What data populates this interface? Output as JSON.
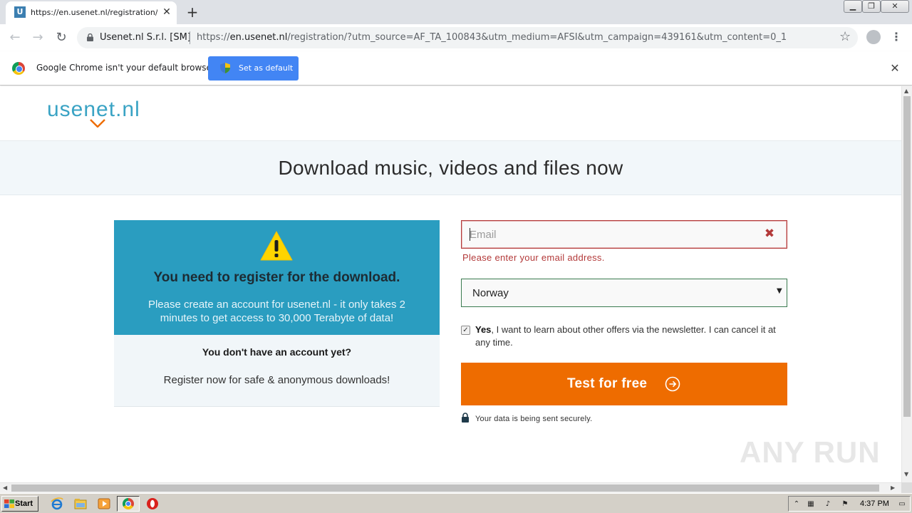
{
  "browser": {
    "tab_title": "https://en.usenet.nl/registration/?utm",
    "tab_favicon_letter": "U",
    "site_identity": "Usenet.nl S.r.l. [SM]",
    "url_prefix": "https://",
    "url_host": "en.usenet.nl",
    "url_path": "/registration/?utm_source=AF_TA_100843&utm_medium=AFSI&utm_campaign=439161&utm_content=0_1",
    "infobar_message": "Google Chrome isn't your default browser",
    "set_default_label": "Set as default"
  },
  "page": {
    "logo_text": "usenet.nl",
    "banner_title": "Download music, videos and files now",
    "card": {
      "heading": "You need to register for the download.",
      "text": "Please create an account for usenet.nl - it only takes 2 minutes to get access to 30,000 Terabyte of data!",
      "question": "You don't have an account yet?",
      "register": "Register now for safe & anonymous downloads!"
    },
    "form": {
      "email_placeholder": "Email",
      "email_value": "",
      "email_error": "Please enter your email address.",
      "country_selected": "Norway",
      "newsletter_checked": true,
      "newsletter_bold": "Yes",
      "newsletter_text": ", I want to learn about other offers via the newsletter. I can cancel it at any time.",
      "cta_label": "Test for free",
      "secure_note": "Your data is being sent securely."
    },
    "watermark": "ANY RUN"
  },
  "taskbar": {
    "start_label": "Start",
    "clock": "4:37 PM"
  },
  "colors": {
    "brand_teal": "#2a9dc0",
    "cta_orange": "#ee6c00",
    "error_red": "#b33a3a",
    "chrome_blue": "#4285f4"
  }
}
